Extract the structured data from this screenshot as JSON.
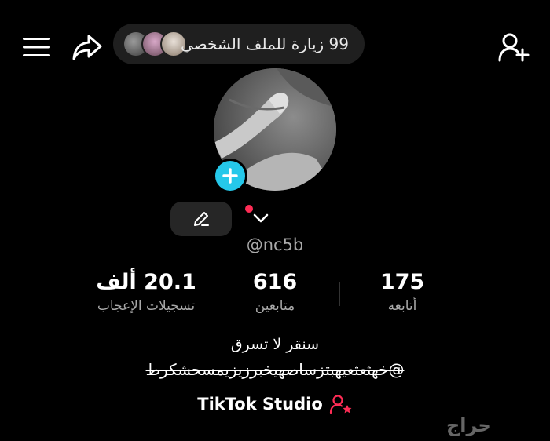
{
  "header": {
    "visits_text": "99 زيارة للملف الشخصي"
  },
  "profile": {
    "username": "@nc5b"
  },
  "stats": [
    {
      "value": "175",
      "label": "أتابعه"
    },
    {
      "value": "616",
      "label": "متابعين"
    },
    {
      "value": "20.1 ألف",
      "label": "تسجيلات الإعجاب"
    }
  ],
  "bio": {
    "line1": "سنقر لا تسرق",
    "line2": "@خهثعثعيهبتزساصهيخبرزيزيمسحشكرط"
  },
  "studio": {
    "label": "TikTok Studio"
  },
  "watermark": "حراج",
  "colors": {
    "background": "#000000",
    "accent_cyan": "#25c8ea",
    "notification_red": "#fe2c55",
    "studio_icon": "#fe2c55"
  },
  "icons": {
    "menu": "hamburger-menu-icon",
    "share": "share-arrow-icon",
    "add_user": "add-user-icon",
    "edit": "pencil-icon",
    "dropdown": "chevron-down-icon",
    "studio": "person-star-icon"
  }
}
